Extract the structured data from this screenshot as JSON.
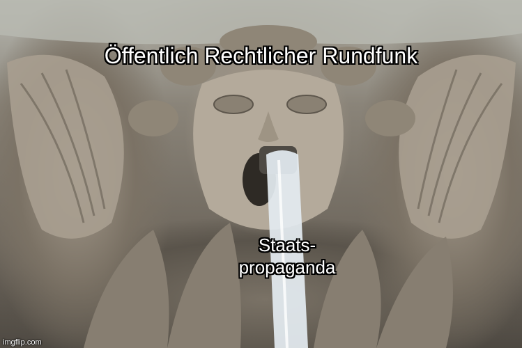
{
  "meme": {
    "top_text": "Öffentlich Rechtlicher Rundfunk",
    "bottom_text_line1": "Staats-",
    "bottom_text_line2": "propaganda",
    "watermark": "imgflip.com"
  },
  "image": {
    "subject_icon": "fountain-spout-face-icon",
    "colors": {
      "stone": "#9d9385",
      "water": "#dfe8ee",
      "text": "#ffffff",
      "outline": "#000000"
    }
  }
}
